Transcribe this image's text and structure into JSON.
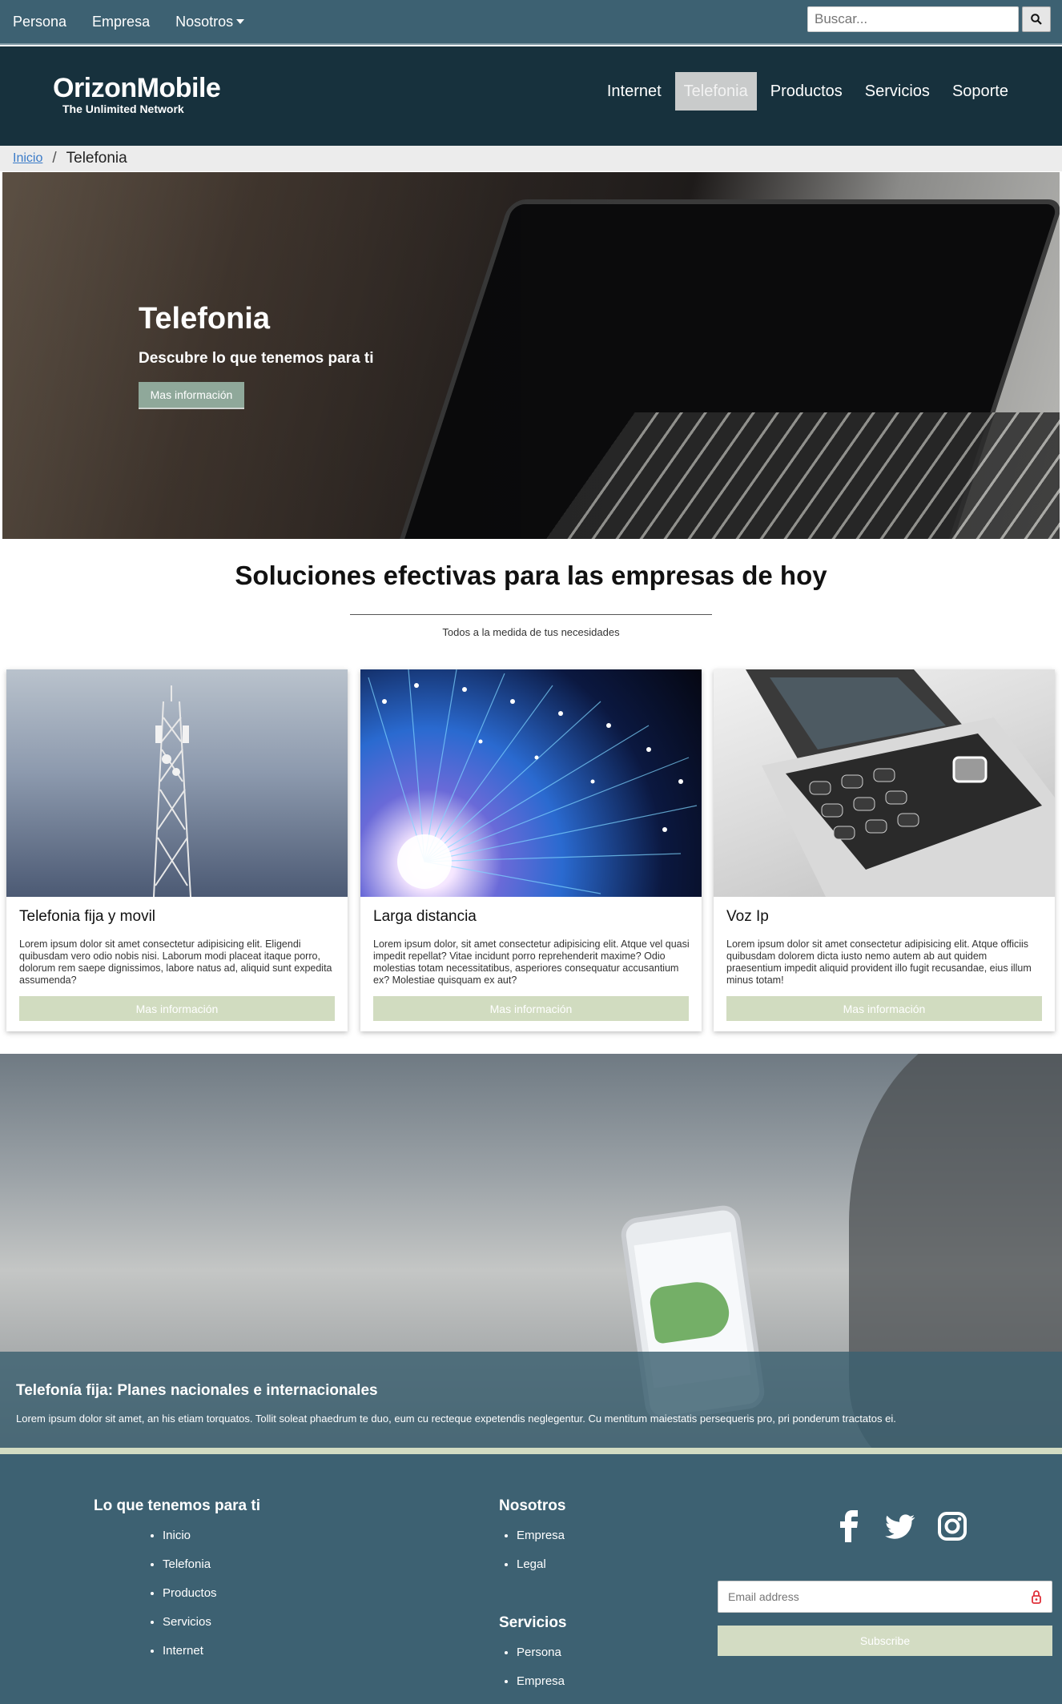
{
  "topbar": {
    "nav": [
      "Persona",
      "Empresa",
      "Nosotros"
    ],
    "search_placeholder": "Buscar..."
  },
  "header": {
    "logo_main": "OrizonMobile",
    "logo_sub": "The Unlimited Network",
    "nav": [
      "Internet",
      "Telefonia",
      "Productos",
      "Servicios",
      "Soporte"
    ],
    "active": "Telefonia"
  },
  "breadcrumb": {
    "home": "Inicio",
    "separator": "/",
    "current": "Telefonia"
  },
  "hero": {
    "title": "Telefonia",
    "subtitle": "Descubre lo que tenemos para ti",
    "button": "Mas información"
  },
  "section": {
    "title": "Soluciones efectivas para las empresas de hoy",
    "subtitle": "Todos a la medida de tus necesidades"
  },
  "cards": [
    {
      "title": "Telefonia fija y movil",
      "text": "Lorem ipsum dolor sit amet consectetur adipisicing elit. Eligendi quibusdam vero odio nobis nisi. Laborum modi placeat itaque porro, dolorum rem saepe dignissimos, labore natus ad, aliquid sunt expedita assumenda?",
      "button": "Mas información"
    },
    {
      "title": "Larga distancia",
      "text": "Lorem ipsum dolor, sit amet consectetur adipisicing elit. Atque vel quasi impedit repellat? Vitae incidunt porro reprehenderit maxime? Odio molestias totam necessitatibus, asperiores consequatur accusantium ex? Molestiae quisquam ex aut?",
      "button": "Mas información"
    },
    {
      "title": "Voz Ip",
      "text": "Lorem ipsum dolor sit amet consectetur adipisicing elit. Atque officiis quibusdam dolorem dicta iusto nemo autem ab aut quidem praesentium impedit aliquid provident illo fugit recusandae, eius illum minus totam!",
      "button": "Mas información"
    }
  ],
  "banner": {
    "title": "Telefonía fija: Planes nacionales e internacionales",
    "text": "Lorem ipsum dolor sit amet, an his etiam torquatos. Tollit soleat phaedrum te duo, eum cu recteque expetendis neglegentur. Cu mentitum maiestatis persequeris pro, pri ponderum tractatos ei."
  },
  "footer": {
    "col1_title": "Lo que tenemos para ti",
    "col1_items": [
      "Inicio",
      "Telefonia",
      "Productos",
      "Servicios",
      "Internet"
    ],
    "col2_title": "Nosotros",
    "col2_items": [
      "Empresa",
      "Legal"
    ],
    "col3_title": "Servicios",
    "col3_items": [
      "Persona",
      "Empresa"
    ],
    "social_icons": [
      "facebook-icon",
      "twitter-icon",
      "instagram-icon"
    ],
    "email_placeholder": "Email address",
    "subscribe": "Subscribe"
  },
  "colors": {
    "topbar": "#3d6172",
    "header": "#17313d",
    "accent": "#d1dcc0",
    "hero_button": "#8fa89a"
  }
}
